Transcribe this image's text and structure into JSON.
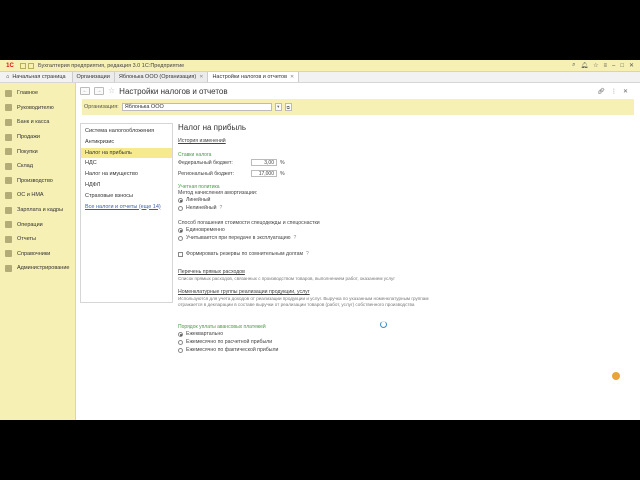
{
  "window": {
    "title": "Бухгалтерия предприятия, редакция 3.0 1С:Предприятие",
    "logo_text": "1С"
  },
  "tabs": {
    "home": "Начальная страница",
    "items": [
      {
        "label": "Организации"
      },
      {
        "label": "Яблонька ООО (Организация)"
      },
      {
        "label": "Настройки налогов и отчетов"
      }
    ]
  },
  "sidebar": {
    "items": [
      {
        "label": "Главное"
      },
      {
        "label": "Руководителю"
      },
      {
        "label": "Банк и касса"
      },
      {
        "label": "Продажи"
      },
      {
        "label": "Покупки"
      },
      {
        "label": "Склад"
      },
      {
        "label": "Производство"
      },
      {
        "label": "ОС и НМА"
      },
      {
        "label": "Зарплата и кадры"
      },
      {
        "label": "Операции"
      },
      {
        "label": "Отчеты"
      },
      {
        "label": "Справочники"
      },
      {
        "label": "Администрирование"
      }
    ]
  },
  "form": {
    "title": "Настройки налогов и отчетов",
    "org_label": "Организация:",
    "org_value": "Яблонька ООО"
  },
  "left_list": {
    "items": [
      {
        "label": "Система налогообложения"
      },
      {
        "label": "Антикризис"
      },
      {
        "label": "Налог на прибыль"
      },
      {
        "label": "НДС"
      },
      {
        "label": "Налог на имущество"
      },
      {
        "label": "НДФЛ"
      },
      {
        "label": "Страховые взносы"
      }
    ],
    "all_link": "Все налоги и отчеты (еще 14)"
  },
  "panel": {
    "title": "Налог на прибыль",
    "history_link": "История изменений",
    "rates_head": "Ставки налога",
    "federal_label": "Федеральный бюджет:",
    "federal_value": "3,00",
    "regional_label": "Региональный бюджет:",
    "regional_value": "17,000",
    "percent": "%",
    "policy_head": "Учетная политика",
    "amort_label": "Метод начисления амортизации:",
    "amort_linear": "Линейный",
    "amort_nonlinear": "Нелинейный",
    "spec_label": "Способ погашения стоимости спецодежды и спецоснастки",
    "spec_once": "Единовременно",
    "spec_at_use": "Учитывается при передаче в эксплуатацию",
    "reserves_label": "Формировать резервы по сомнительным долгам",
    "direct_link": "Перечень прямых расходов",
    "direct_desc": "Список прямых расходов, связанных с производством товаров, выполнением работ, оказанием услуг",
    "nomen_link": "Номенклатурные группы реализации продукции, услуг",
    "nomen_desc": "Используются для учета доходов от реализации продукции и услуг. Выручка по указанным номенклатурным группам отражается в декларации в составе выручки от реализации товаров (работ, услуг) собственного производства",
    "advance_head": "Порядок уплаты авансовых платежей",
    "adv_quarterly": "Ежеквартально",
    "adv_monthly_calc": "Ежемесячно по расчетной прибыли",
    "adv_monthly_fact": "Ежемесячно по фактической прибыли",
    "question": "?"
  }
}
